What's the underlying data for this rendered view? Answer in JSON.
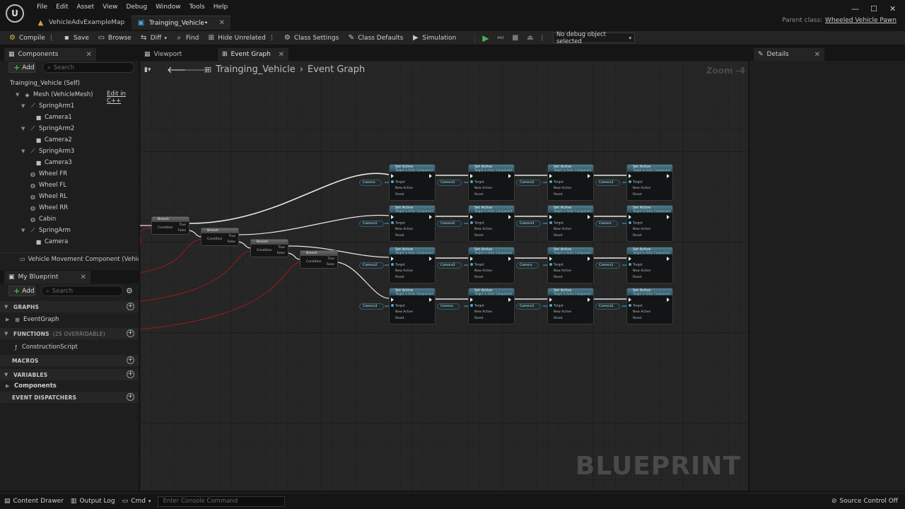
{
  "app": {
    "menu": [
      "File",
      "Edit",
      "Asset",
      "View",
      "Debug",
      "Window",
      "Tools",
      "Help"
    ],
    "doc_tabs": [
      {
        "label": "VehicleAdvExampleMap",
        "active": false
      },
      {
        "label": "Trainging_Vehicle•",
        "active": true
      }
    ],
    "parent_class_label": "Parent class:",
    "parent_class_value": "Wheeled Vehicle Pawn"
  },
  "toolbar": {
    "compile": "Compile",
    "save": "Save",
    "browse": "Browse",
    "diff": "Diff",
    "find": "Find",
    "hide_unrelated": "Hide Unrelated",
    "class_settings": "Class Settings",
    "class_defaults": "Class Defaults",
    "simulation": "Simulation",
    "debug_object": "No debug object selected"
  },
  "components": {
    "tab_label": "Components",
    "add_label": "Add",
    "search_placeholder": "Search",
    "edit_in_cpp": "Edit in C++",
    "items": [
      {
        "label": "Trainging_Vehicle (Self)",
        "indent": 0,
        "icon": "none",
        "arrow": false
      },
      {
        "label": "Mesh (VehicleMesh)",
        "indent": 1,
        "icon": "mesh-icon",
        "arrow": true
      },
      {
        "label": "SpringArm1",
        "indent": 2,
        "icon": "spring-arm-icon",
        "arrow": true
      },
      {
        "label": "Camera1",
        "indent": 3,
        "icon": "camera-icon",
        "arrow": false
      },
      {
        "label": "SpringArm2",
        "indent": 2,
        "icon": "spring-arm-icon",
        "arrow": true
      },
      {
        "label": "Camera2",
        "indent": 3,
        "icon": "camera-icon",
        "arrow": false
      },
      {
        "label": "SpringArm3",
        "indent": 2,
        "icon": "spring-arm-icon",
        "arrow": true
      },
      {
        "label": "Camera3",
        "indent": 3,
        "icon": "camera-icon",
        "arrow": false
      },
      {
        "label": "Wheel FR",
        "indent": 2,
        "icon": "wheel-icon",
        "arrow": false
      },
      {
        "label": "Wheel FL",
        "indent": 2,
        "icon": "wheel-icon",
        "arrow": false
      },
      {
        "label": "Wheel RL",
        "indent": 2,
        "icon": "wheel-icon",
        "arrow": false
      },
      {
        "label": "Wheel RR",
        "indent": 2,
        "icon": "wheel-icon",
        "arrow": false
      },
      {
        "label": "Cabin",
        "indent": 2,
        "icon": "wheel-icon",
        "arrow": false
      },
      {
        "label": "SpringArm",
        "indent": 2,
        "icon": "spring-arm-icon",
        "arrow": true
      },
      {
        "label": "Camera",
        "indent": 3,
        "icon": "camera-icon",
        "arrow": false
      }
    ],
    "movement_component": "Vehicle Movement Component (VehicleM"
  },
  "my_blueprint": {
    "tab_label": "My Blueprint",
    "add_label": "Add",
    "search_placeholder": "Search",
    "sections": {
      "graphs": "GRAPHS",
      "event_graph": "EventGraph",
      "functions": "FUNCTIONS",
      "functions_sub": "(25 OVERRIDABLE)",
      "construction_script": "ConstructionScript",
      "macros": "MACROS",
      "variables": "VARIABLES",
      "components": "Components",
      "event_dispatchers": "EVENT DISPATCHERS"
    }
  },
  "graph": {
    "tabs": [
      "Viewport",
      "Event Graph"
    ],
    "breadcrumb_root": "Trainging_Vehicle",
    "breadcrumb_current": "Event Graph",
    "zoom": "Zoom -4",
    "watermark": "BLUEPRINT",
    "node_title": "Set Active",
    "node_subtitle": "Target is Actor Component",
    "pin_target": "Target",
    "pin_new_active": "New Active",
    "pin_reset": "Reset",
    "var_labels": [
      "Camera",
      "Camera1",
      "Camera2",
      "Camera3"
    ],
    "branch_title": "Branch",
    "branch_condition": "Condition",
    "branch_true": "True",
    "branch_false": "False"
  },
  "details": {
    "tab_label": "Details"
  },
  "statusbar": {
    "content_drawer": "Content Drawer",
    "output_log": "Output Log",
    "cmd": "Cmd",
    "console_placeholder": "Enter Console Command",
    "source_control": "Source Control Off"
  }
}
